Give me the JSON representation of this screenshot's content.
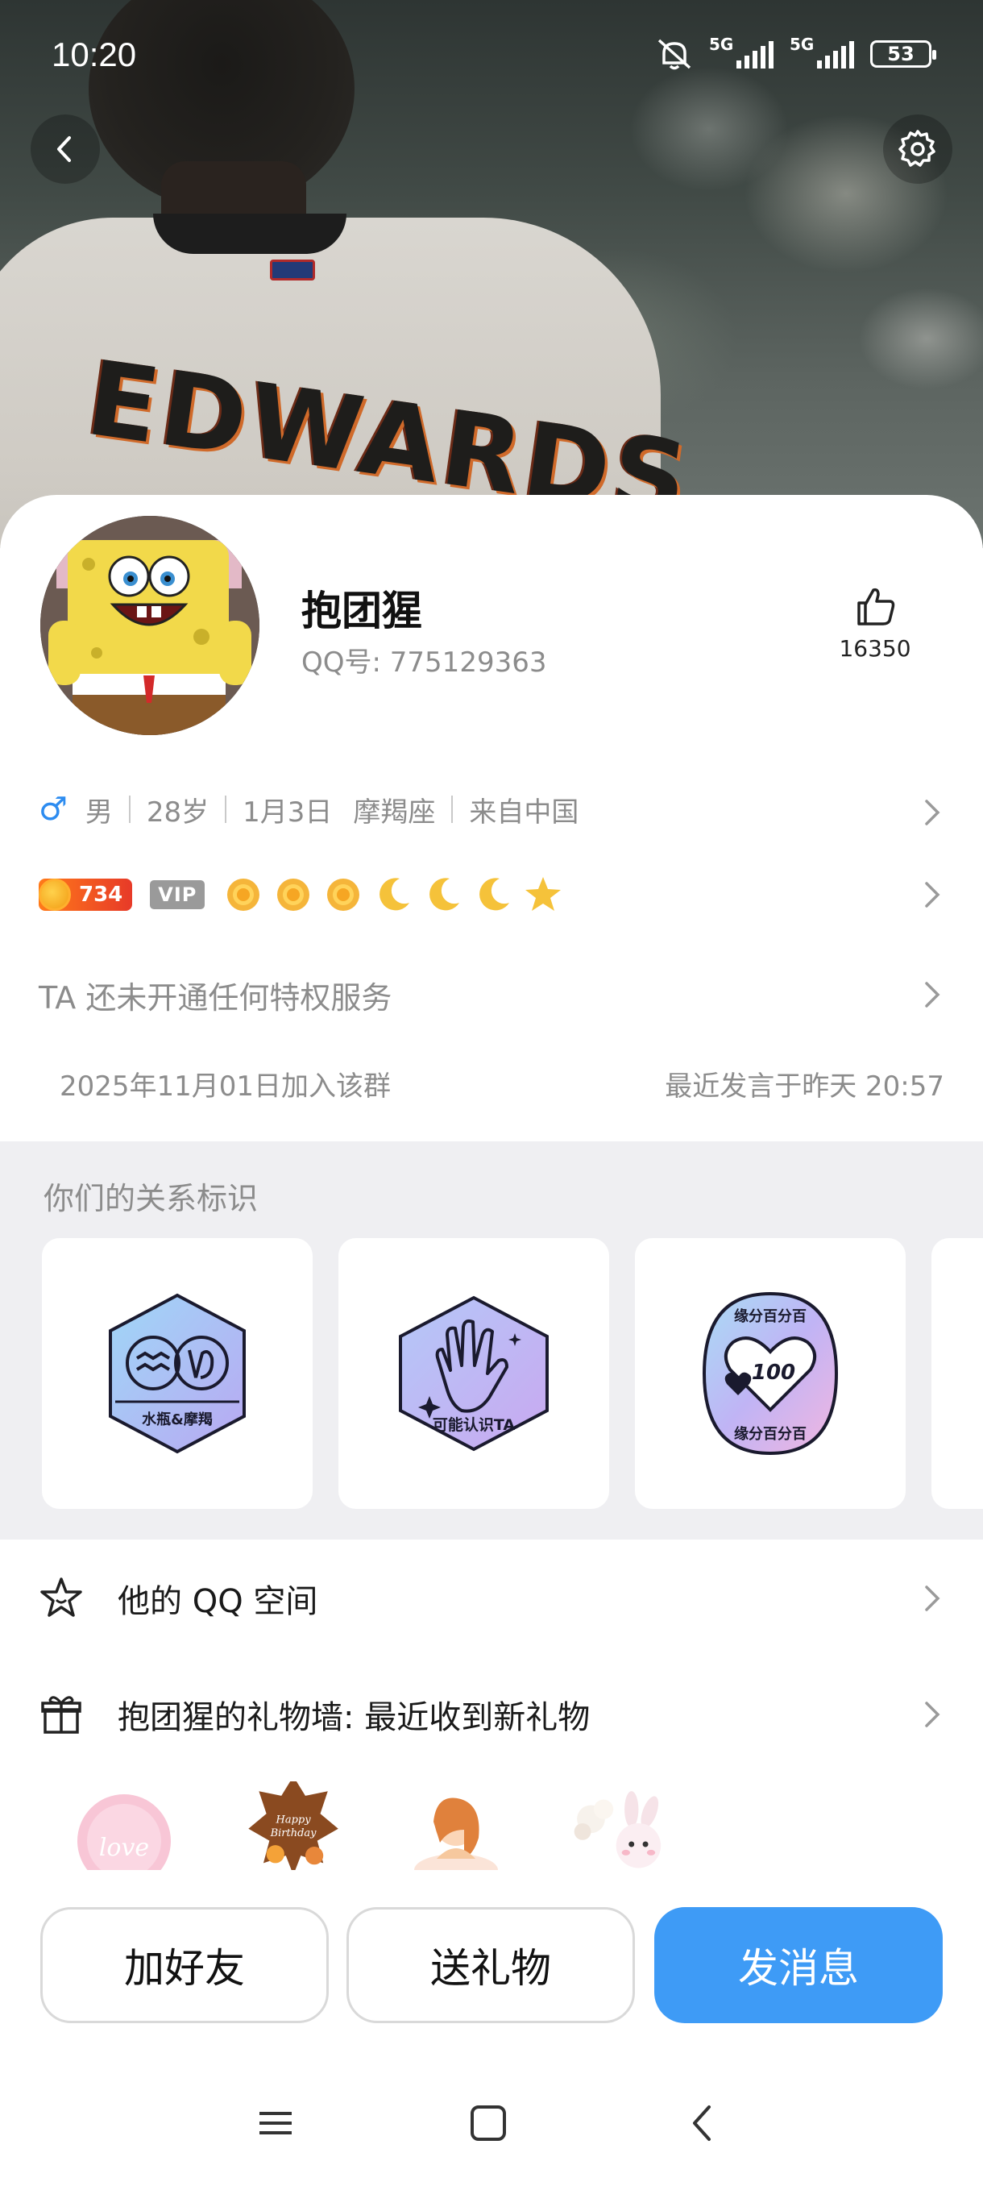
{
  "status_bar": {
    "time": "10:20",
    "network_1": "5G",
    "network_2": "5G",
    "battery": "53"
  },
  "profile": {
    "nickname": "抱团猩",
    "qq_label": "QQ号: 775129363",
    "like_count": "16350"
  },
  "basic_info": {
    "gender": "男",
    "age": "28岁",
    "birthday": "1月3日",
    "zodiac": "摩羯座",
    "location": "来自中国"
  },
  "level": {
    "points": "734",
    "vip_label": "VIP",
    "icons": [
      "sun-icon",
      "sun-icon",
      "sun-icon",
      "moon-icon",
      "moon-icon",
      "moon-icon",
      "star-icon"
    ]
  },
  "privilege": {
    "text": "TA 还未开通任何特权服务"
  },
  "group_info": {
    "joined": "2025年11月01日加入该群",
    "last_spoke": "最近发言于昨天 20:57"
  },
  "relationship": {
    "title": "你们的关系标识",
    "badges": [
      {
        "label": "水瓶&摩羯",
        "icon": "aquarius-capricorn-icon"
      },
      {
        "label": "可能认识TA",
        "icon": "hand-wave-icon"
      },
      {
        "label": "缘分百分百",
        "icon": "heart-100-icon"
      }
    ]
  },
  "menu": {
    "qzone": "他的 QQ 空间",
    "gift_wall": "抱团猩的礼物墙: 最近收到新礼物"
  },
  "gifts": {
    "items": [
      "love",
      "Happy Birthday"
    ]
  },
  "actions": {
    "add_friend": "加好友",
    "send_gift": "送礼物",
    "send_message": "发消息"
  },
  "colors": {
    "accent": "#3e9bf6",
    "gender_male": "#2d8cf0",
    "level_badge": "#e73a28",
    "section_bg": "#efeff2"
  }
}
